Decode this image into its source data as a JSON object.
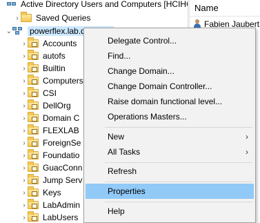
{
  "window": {
    "root_label": "Active Directory Users and Computers [HCIHC"
  },
  "tree": {
    "saved_queries": "Saved Queries",
    "domain": "powerflex.lab.dell.com",
    "items": [
      "Accounts",
      "autofs",
      "Builtin",
      "Computers",
      "CSI",
      "DellOrg",
      "Domain C",
      "FLEXLAB",
      "ForeignSe",
      "Foundatio",
      "GuacConn",
      "Jump Serv",
      "Keys",
      "LabAdmin",
      "LabUsers"
    ]
  },
  "right_pane": {
    "column_header": "Name",
    "first_user": "Fabien Jaubert"
  },
  "context_menu": {
    "items": [
      {
        "label": "Delegate Control..."
      },
      {
        "label": "Find..."
      },
      {
        "label": "Change Domain..."
      },
      {
        "label": "Change Domain Controller..."
      },
      {
        "label": "Raise domain functional level..."
      },
      {
        "label": "Operations Masters..."
      },
      {
        "label": "New",
        "submenu": true
      },
      {
        "label": "All Tasks",
        "submenu": true
      },
      {
        "label": "Refresh"
      },
      {
        "label": "Properties",
        "highlighted": true
      },
      {
        "label": "Help"
      }
    ],
    "submenu_glyph": "›"
  },
  "colors": {
    "menu_bg": "#f2f2f2",
    "highlight": "#91c9f7",
    "selection": "#cce8ff",
    "folder": "#f4c852"
  }
}
